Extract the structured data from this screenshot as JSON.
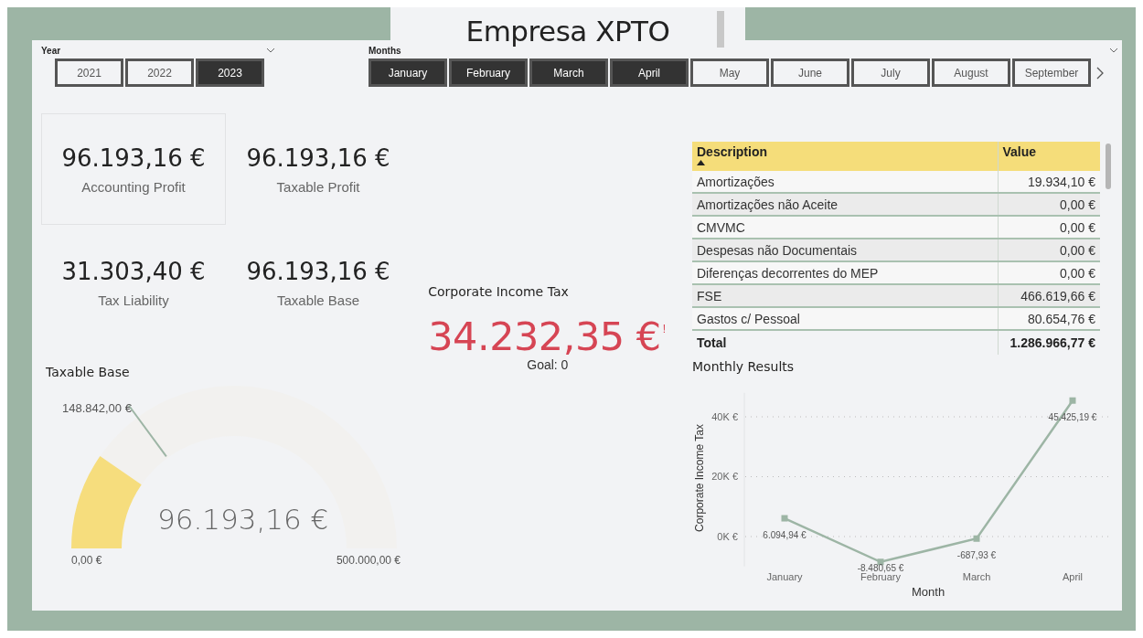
{
  "title": "Empresa XPTO",
  "year_slicer": {
    "label": "Year",
    "options": [
      {
        "label": "2021",
        "selected": false
      },
      {
        "label": "2022",
        "selected": false
      },
      {
        "label": "2023",
        "selected": true
      }
    ]
  },
  "months_slicer": {
    "label": "Months",
    "options": [
      {
        "label": "January",
        "selected": true
      },
      {
        "label": "February",
        "selected": true
      },
      {
        "label": "March",
        "selected": true
      },
      {
        "label": "April",
        "selected": true
      },
      {
        "label": "May",
        "selected": false
      },
      {
        "label": "June",
        "selected": false
      },
      {
        "label": "July",
        "selected": false
      },
      {
        "label": "August",
        "selected": false
      },
      {
        "label": "September",
        "selected": false
      }
    ]
  },
  "kpis": [
    {
      "value": "96.193,16 €",
      "label": "Accounting Profit",
      "selected": true
    },
    {
      "value": "96.193,16 €",
      "label": "Taxable Profit",
      "selected": false
    },
    {
      "value": "31.303,40 €",
      "label": "Tax Liability",
      "selected": false
    },
    {
      "value": "96.193,16 €",
      "label": "Taxable Base",
      "selected": false
    }
  ],
  "gauge": {
    "title": "Taxable Base",
    "value": "96.193,16 €",
    "level": 0.192,
    "target": "148.842,00 €",
    "target_marker": {
      "level": 0.298
    },
    "min": "0,00 €",
    "max": "500.000,00 €"
  },
  "corporate_tax": {
    "title": "Corporate Income Tax",
    "value": "34.232,35 €",
    "alert": "!",
    "goal": "Goal: 0"
  },
  "table": {
    "columns": [
      "Description",
      "Value"
    ],
    "rows": [
      [
        "Amortizações",
        "19.934,10 €"
      ],
      [
        "Amortizações não Aceite",
        "0,00 €"
      ],
      [
        "CMVMC",
        "0,00 €"
      ],
      [
        "Despesas não Documentais",
        "0,00 €"
      ],
      [
        "Diferenças decorrentes do MEP",
        "0,00 €"
      ],
      [
        "FSE",
        "466.619,66 €"
      ],
      [
        "Gastos c/ Pessoal",
        "80.654,76 €"
      ]
    ],
    "total": [
      "Total",
      "1.286.966,77 €"
    ]
  },
  "monthly_results": {
    "title": "Monthly Results",
    "chart_data": {
      "type": "line",
      "xlabel": "Month",
      "ylabel": "Corporate Income Tax",
      "grid": true,
      "categories": [
        "January",
        "February",
        "March",
        "April"
      ],
      "series": [
        {
          "color": "#9db5a5",
          "marker": "square",
          "values": [
            6094.94,
            -8480.65,
            -687.93,
            45425.19
          ]
        }
      ],
      "value_labels": [
        "6.094,94 €",
        "-8.480,65 €",
        "-687,93 €",
        "45.425,19 €"
      ],
      "ylim": [
        -10000,
        48000
      ],
      "yticks": [
        {
          "value": 0,
          "label": "0K €"
        },
        {
          "value": 20000,
          "label": "20K €"
        },
        {
          "value": 40000,
          "label": "40K €"
        }
      ]
    }
  }
}
